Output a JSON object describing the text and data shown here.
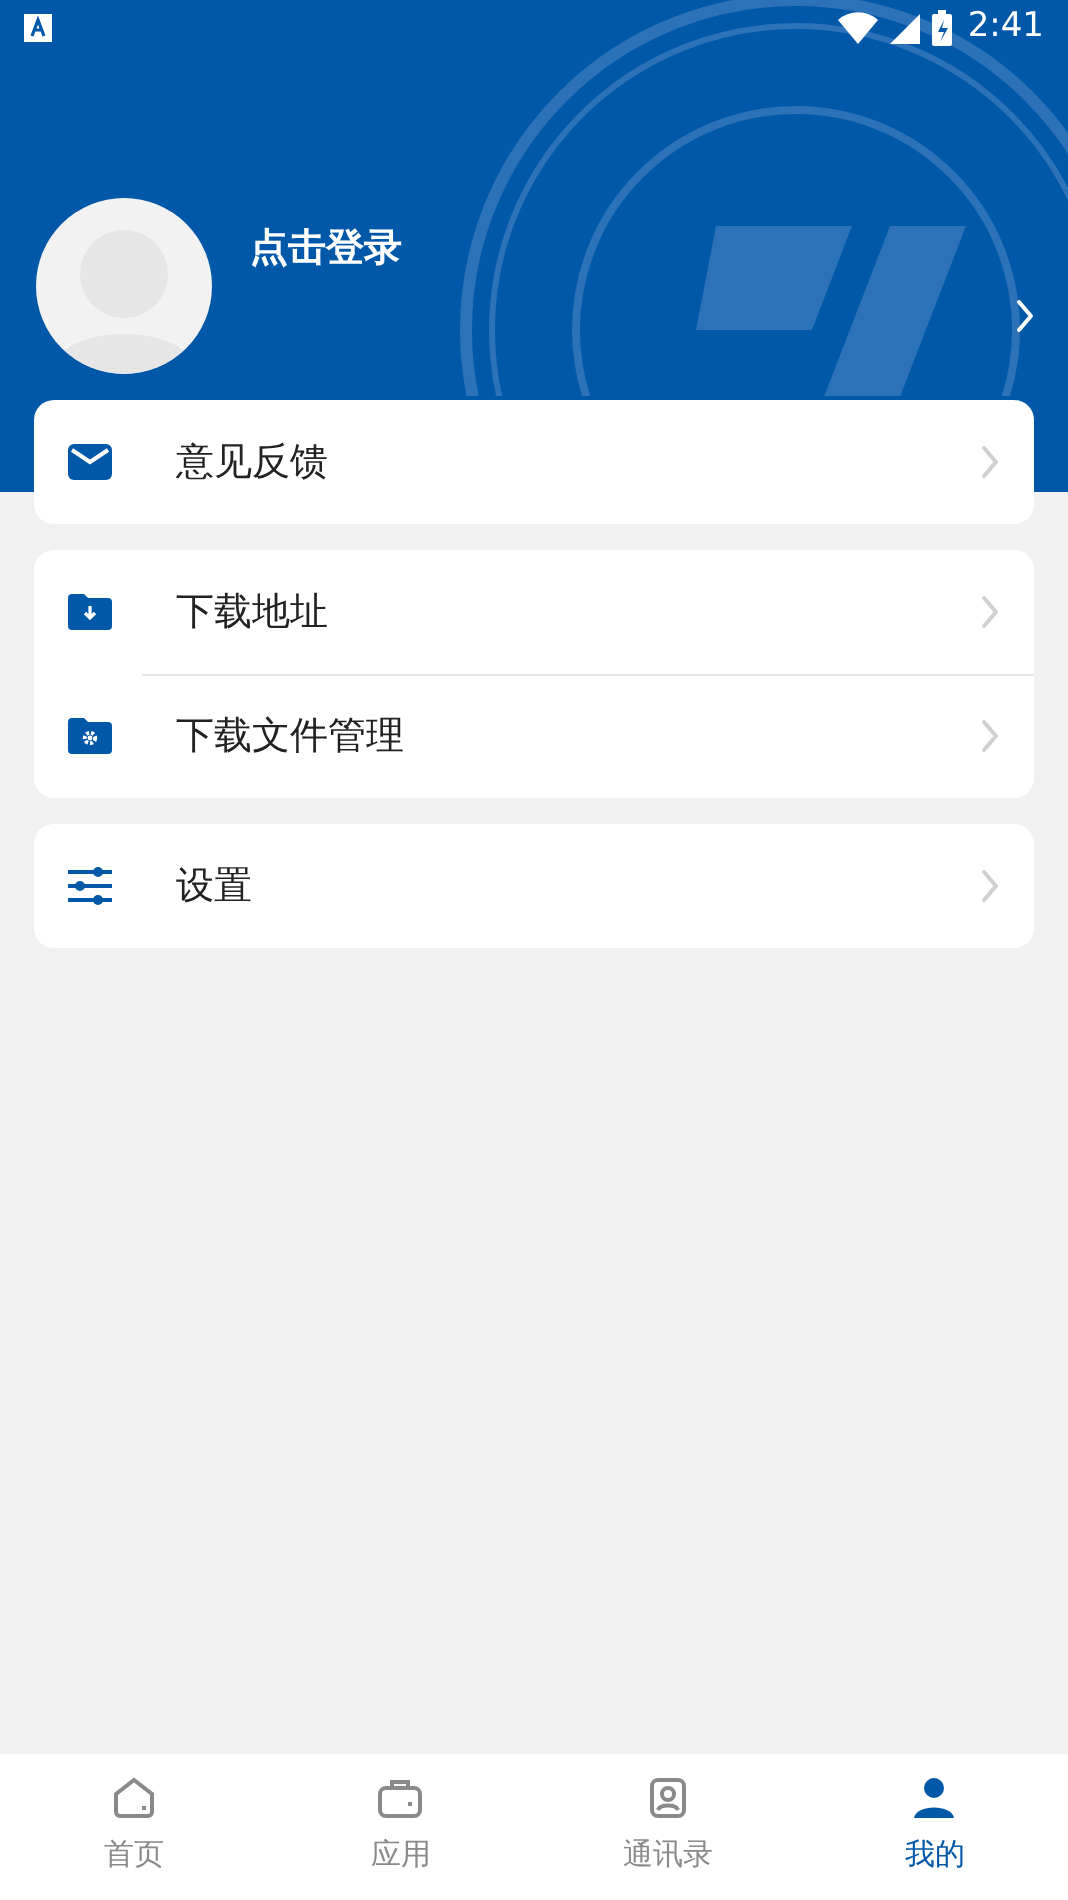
{
  "status_bar": {
    "time": "2:41"
  },
  "profile": {
    "login_text": "点击登录"
  },
  "menu_groups": [
    {
      "items": [
        {
          "kind": "mail",
          "label": "意见反馈"
        }
      ]
    },
    {
      "items": [
        {
          "kind": "download-folder",
          "label": "下载地址"
        },
        {
          "kind": "gear-folder",
          "label": "下载文件管理"
        }
      ]
    },
    {
      "items": [
        {
          "kind": "sliders",
          "label": "设置"
        }
      ]
    }
  ],
  "tab_bar": [
    {
      "kind": "home",
      "label": "首页",
      "selected": false
    },
    {
      "kind": "apps",
      "label": "应用",
      "selected": false
    },
    {
      "kind": "contacts",
      "label": "通讯录",
      "selected": false
    },
    {
      "kind": "me",
      "label": "我的",
      "selected": true
    }
  ]
}
